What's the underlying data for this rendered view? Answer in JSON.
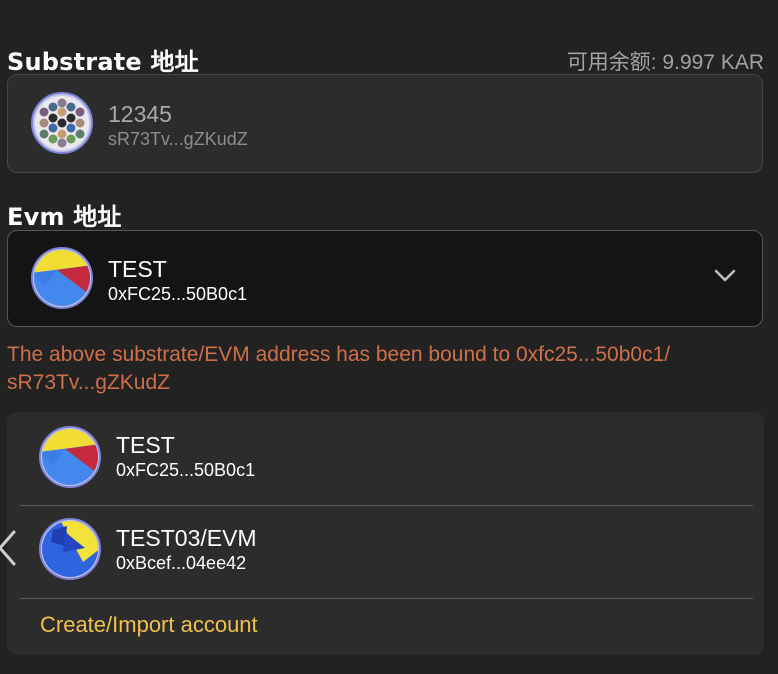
{
  "substrate": {
    "title": "Substrate 地址",
    "balance_label": "可用余额: 9.997 KAR",
    "account": {
      "name": "12345",
      "address": "sR73Tv...gZKudZ",
      "avatar_icon": "polkadot-identicon"
    }
  },
  "evm": {
    "title": "Evm 地址",
    "selected": {
      "name": "TEST",
      "address": "0xFC25...50B0c1",
      "avatar_icon": "blockie-avatar"
    },
    "dropdown_icon": "chevron-down-icon"
  },
  "warning_text": "The above substrate/EVM address has been bound to 0xfc25...50b0c1/ sR73Tv...gZKudZ",
  "dropdown": {
    "items": [
      {
        "name": "TEST",
        "address": "0xFC25...50B0c1"
      },
      {
        "name": "TEST03/EVM",
        "address": "0xBcef...04ee42"
      }
    ],
    "create_label": "Create/Import account"
  },
  "colors": {
    "background": "#222223",
    "card": "#2c2c2d",
    "selected_card": "#141415",
    "warning": "#cf7048",
    "link": "#f1c148"
  }
}
